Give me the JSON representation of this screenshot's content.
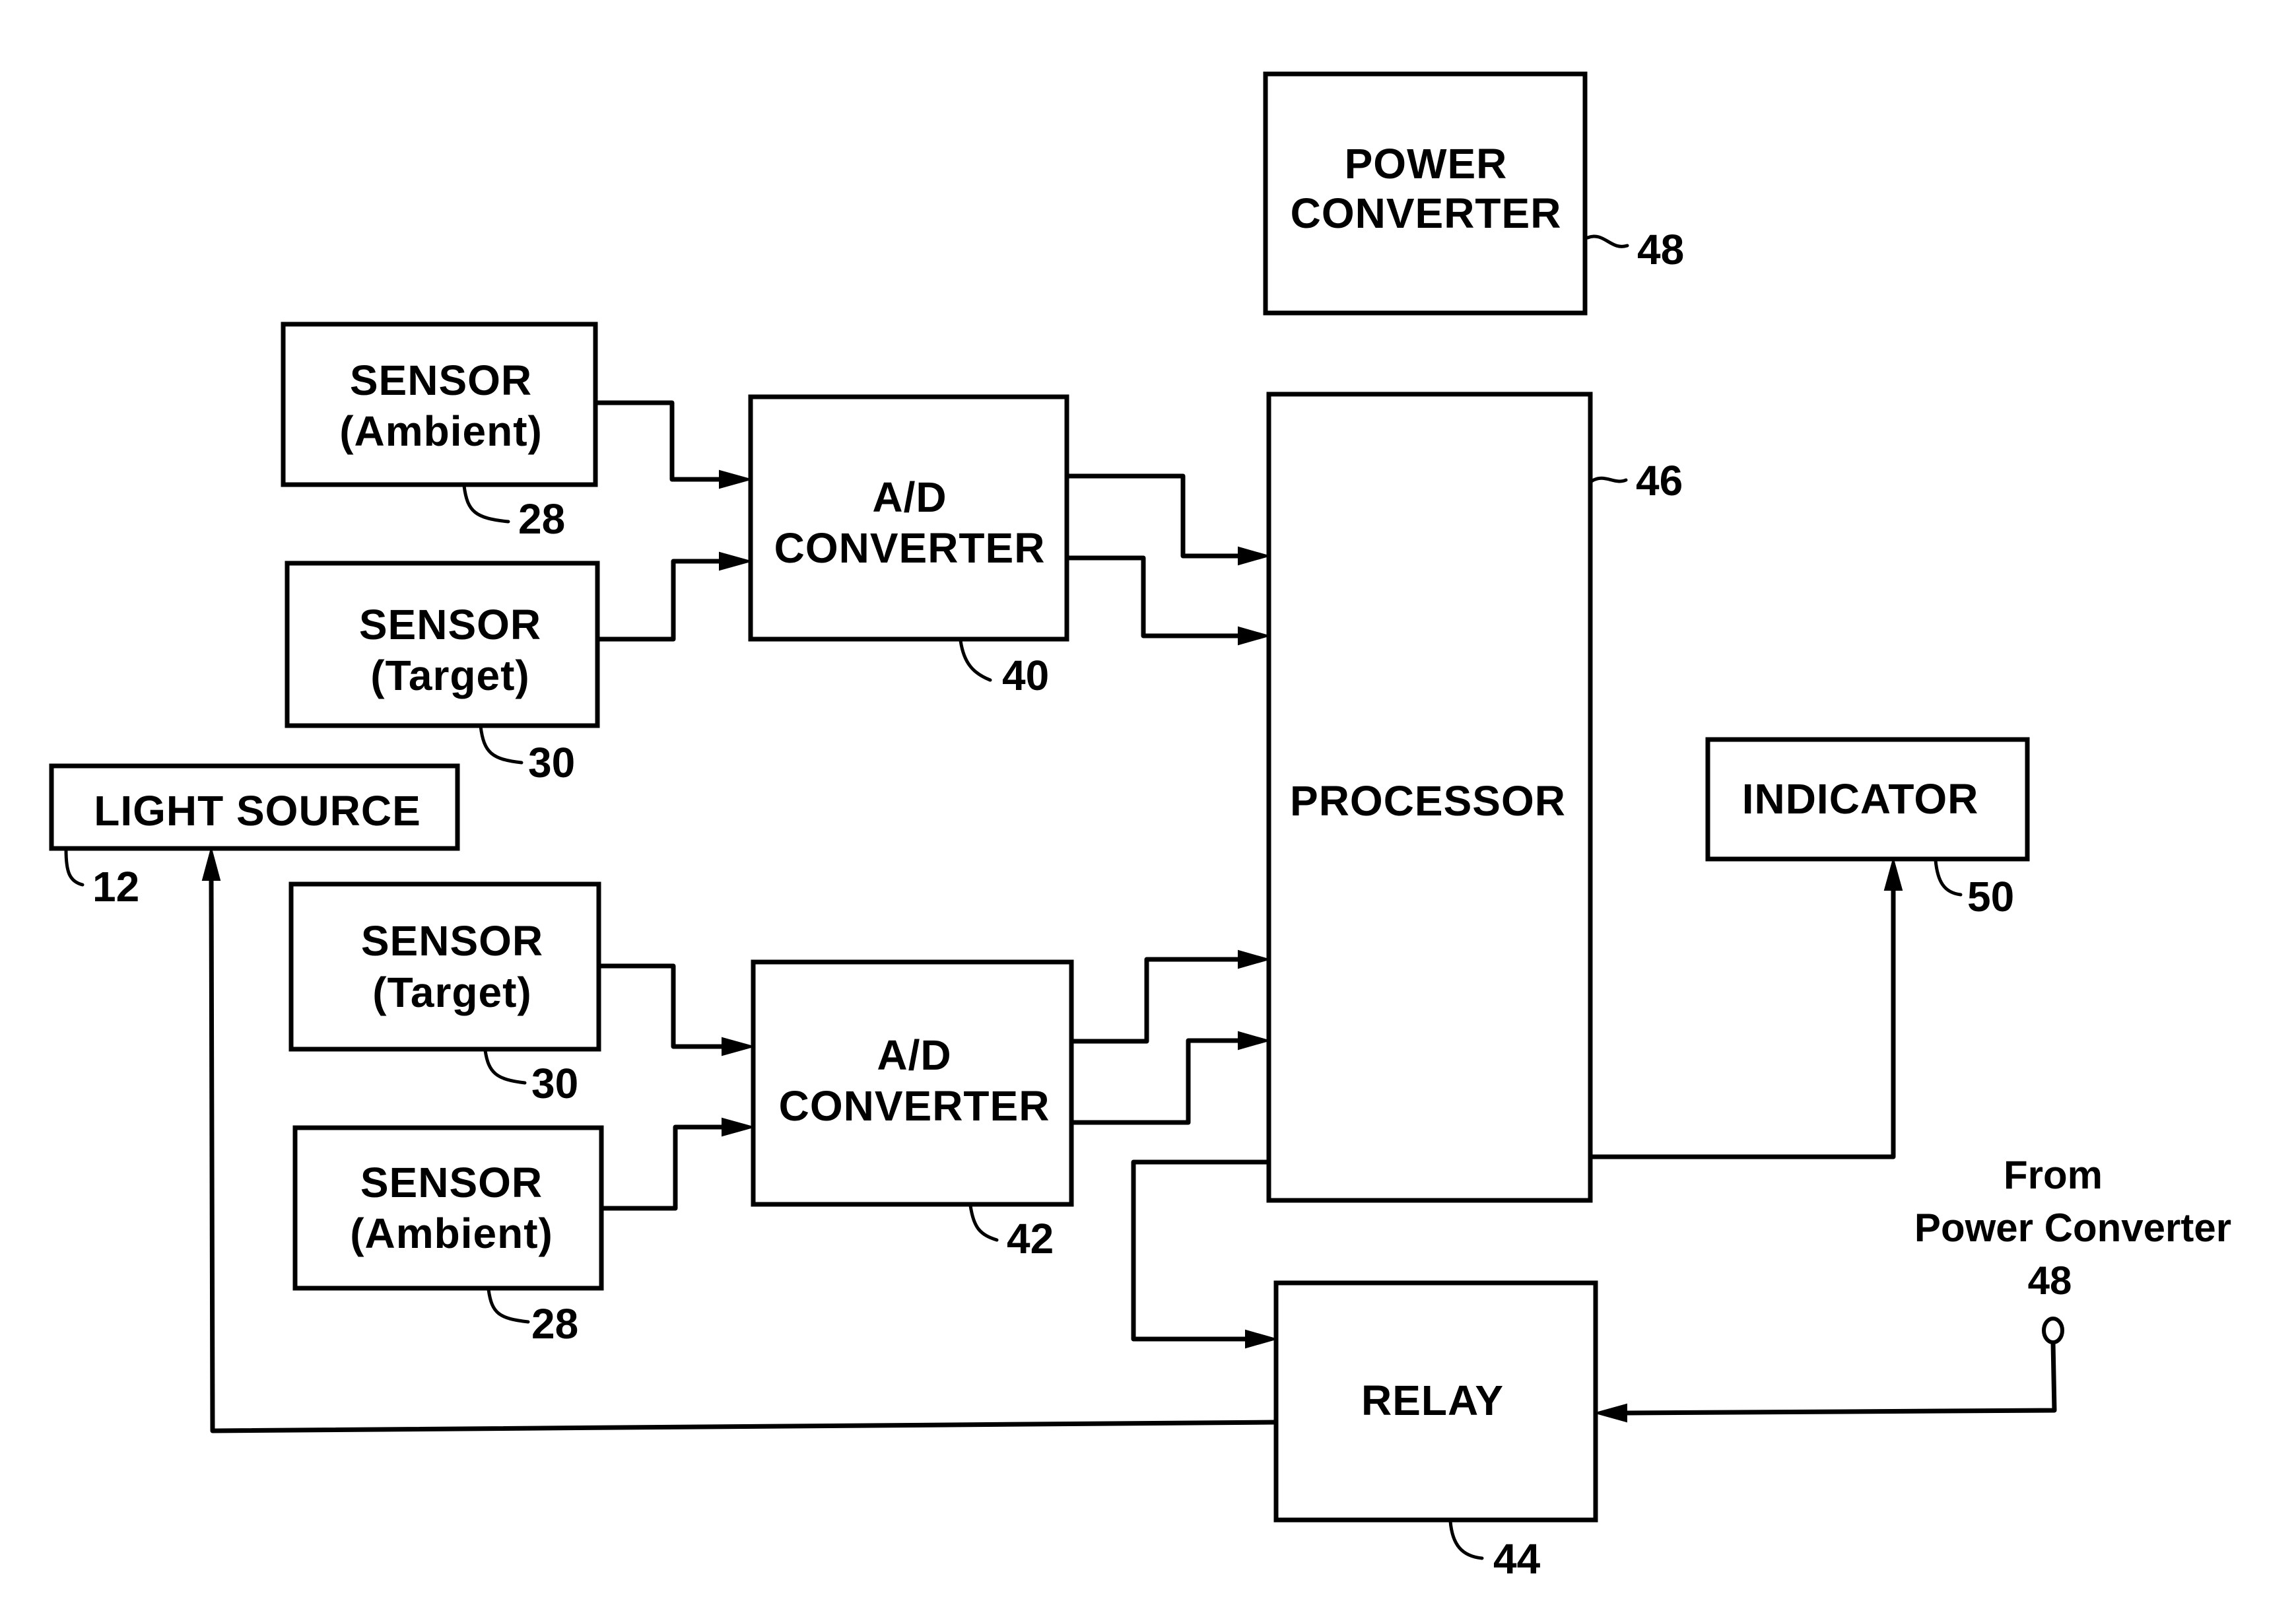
{
  "figure": {
    "blocks": [
      {
        "id": "power-converter",
        "lines": [
          "POWER",
          "CONVERTER"
        ],
        "ref": "48"
      },
      {
        "id": "sensor-ambient-1",
        "lines": [
          "SENSOR",
          "(Ambient)"
        ],
        "ref": "28"
      },
      {
        "id": "sensor-target-1",
        "lines": [
          "SENSOR",
          "(Target)"
        ],
        "ref": "30"
      },
      {
        "id": "ad-converter-1",
        "lines": [
          "A/D",
          "CONVERTER"
        ],
        "ref": "40"
      },
      {
        "id": "processor",
        "lines": [
          "PROCESSOR"
        ],
        "ref": "46"
      },
      {
        "id": "light-source",
        "lines": [
          "LIGHT SOURCE"
        ],
        "ref": "12"
      },
      {
        "id": "indicator",
        "lines": [
          "INDICATOR"
        ],
        "ref": "50"
      },
      {
        "id": "sensor-target-2",
        "lines": [
          "SENSOR",
          "(Target)"
        ],
        "ref": "30"
      },
      {
        "id": "sensor-ambient-2",
        "lines": [
          "SENSOR",
          "(Ambient)"
        ],
        "ref": "28"
      },
      {
        "id": "ad-converter-2",
        "lines": [
          "A/D",
          "CONVERTER"
        ],
        "ref": "42"
      },
      {
        "id": "relay",
        "lines": [
          "RELAY"
        ],
        "ref": "44"
      }
    ],
    "external_input": {
      "lines": [
        "From",
        "Power Converter",
        "48"
      ]
    },
    "connections": [
      {
        "from": "sensor-ambient-1",
        "to": "ad-converter-1"
      },
      {
        "from": "sensor-target-1",
        "to": "ad-converter-1"
      },
      {
        "from": "ad-converter-1",
        "to": "processor"
      },
      {
        "from": "ad-converter-1",
        "to": "processor"
      },
      {
        "from": "sensor-target-2",
        "to": "ad-converter-2"
      },
      {
        "from": "sensor-ambient-2",
        "to": "ad-converter-2"
      },
      {
        "from": "ad-converter-2",
        "to": "processor"
      },
      {
        "from": "ad-converter-2",
        "to": "processor"
      },
      {
        "from": "processor",
        "to": "indicator"
      },
      {
        "from": "processor",
        "to": "relay"
      },
      {
        "from": "relay",
        "to": "light-source"
      },
      {
        "from": "power-converter-48-terminal",
        "to": "relay"
      }
    ]
  }
}
